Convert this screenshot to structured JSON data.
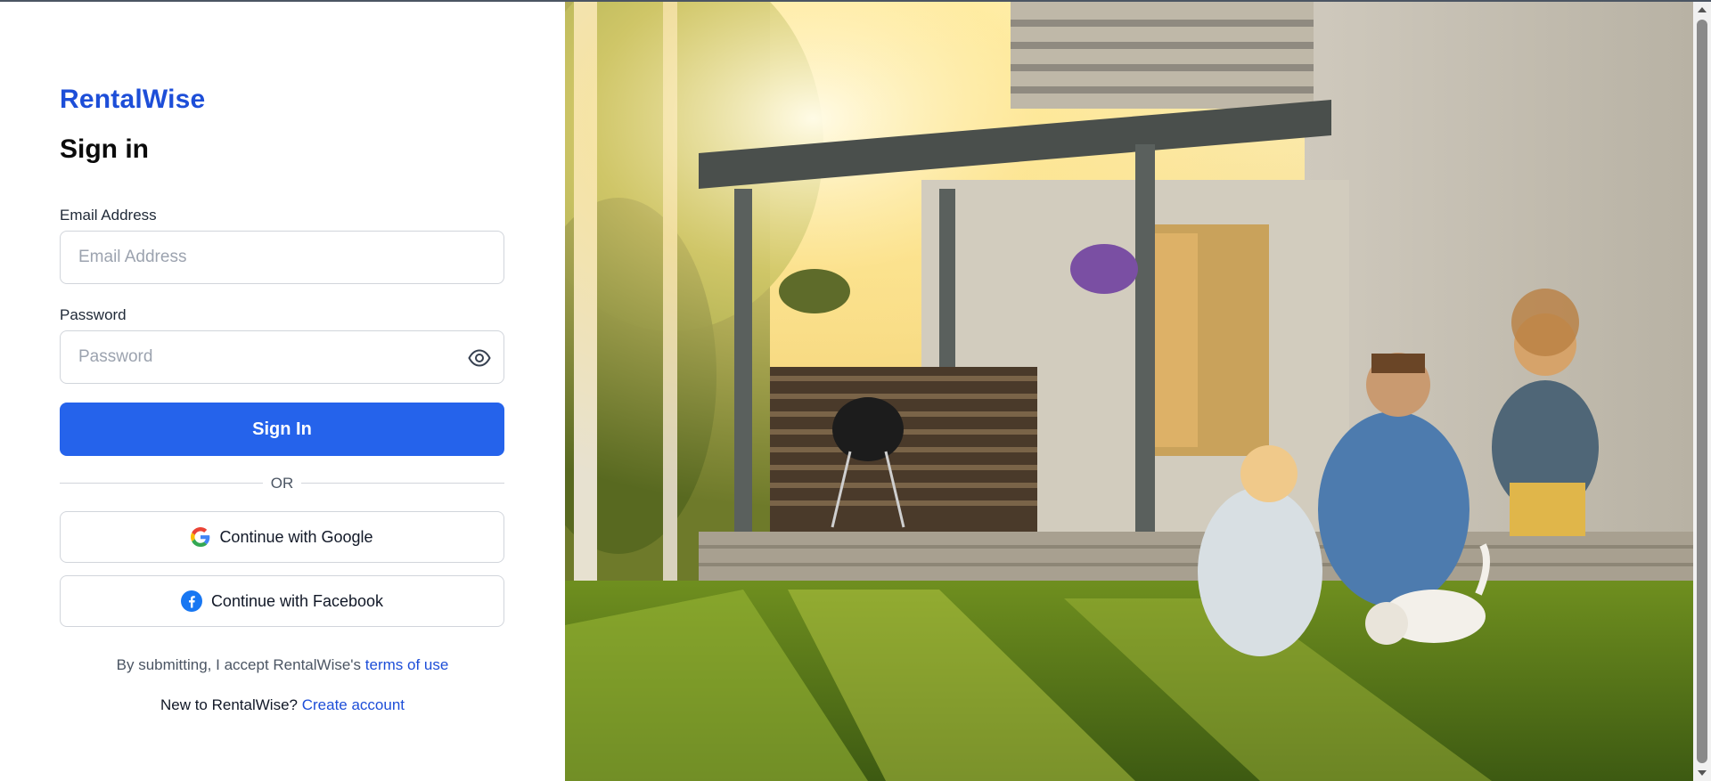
{
  "app": {
    "brand": "RentalWise",
    "heading": "Sign in"
  },
  "form": {
    "email": {
      "label": "Email Address",
      "placeholder": "Email Address",
      "value": ""
    },
    "password": {
      "label": "Password",
      "placeholder": "Password",
      "value": "",
      "toggle_icon": "eye-icon"
    },
    "submit_label": "Sign In",
    "divider_text": "OR"
  },
  "social": {
    "google_label": "Continue with Google",
    "google_icon": "google-icon",
    "facebook_label": "Continue with Facebook",
    "facebook_icon": "facebook-icon"
  },
  "footer": {
    "terms_prefix": "By submitting, I accept RentalWise's",
    "terms_link": "terms of use",
    "new_prefix": "New to RentalWise?",
    "create_link": "Create account"
  },
  "colors": {
    "accent": "#2563eb",
    "brand": "#1d4ed8",
    "facebook": "#1877f2"
  }
}
